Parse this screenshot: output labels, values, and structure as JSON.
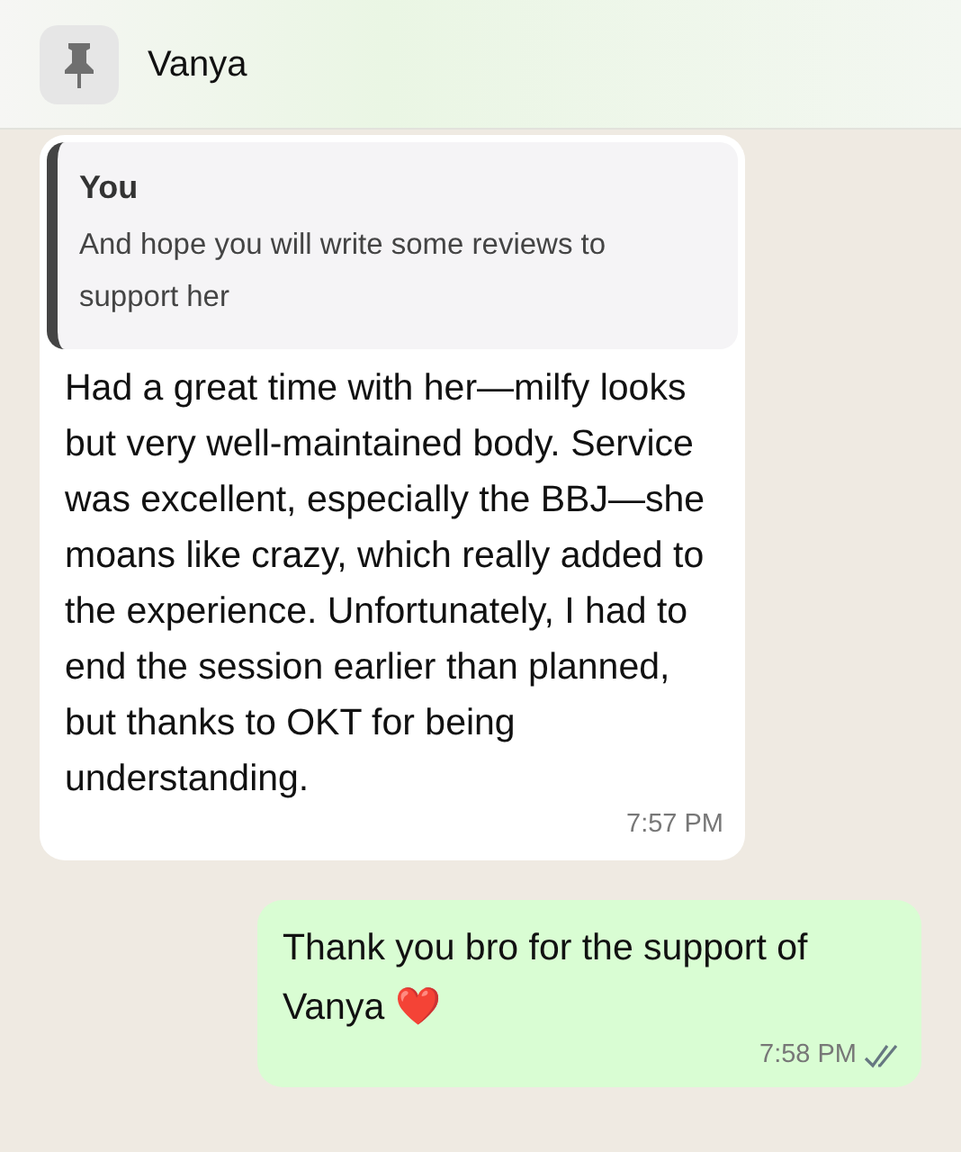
{
  "pinned": {
    "title": "Vanya"
  },
  "messages": [
    {
      "kind": "incoming",
      "quote": {
        "author": "You",
        "text": "And hope you will write some reviews to support her"
      },
      "text": "Had a great time with her—milfy looks but very well-maintained body. Service was excellent, especially the BBJ—she moans like crazy, which really added to the experience. Unfortunately, I had to end the session earlier than planned, but thanks to OKT for being understanding.",
      "time": "7:57 PM"
    },
    {
      "kind": "outgoing",
      "text": "Thank you bro for the support of Vanya ❤️",
      "time": "7:58 PM",
      "delivered": true
    }
  ]
}
